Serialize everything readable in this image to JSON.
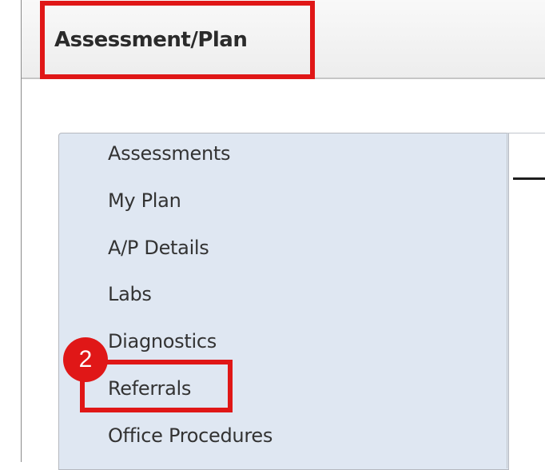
{
  "header": {
    "title": "Assessment/Plan"
  },
  "menu": {
    "items": [
      {
        "label": "Assessments"
      },
      {
        "label": "My Plan"
      },
      {
        "label": "A/P Details"
      },
      {
        "label": "Labs"
      },
      {
        "label": "Diagnostics"
      },
      {
        "label": "Referrals"
      },
      {
        "label": "Office Procedures"
      }
    ]
  },
  "annotations": {
    "step_badge": "2",
    "highlight_color": "#e01717"
  },
  "colors": {
    "panel_background": "#dfe7f2",
    "header_background": "#f2f2f2"
  }
}
